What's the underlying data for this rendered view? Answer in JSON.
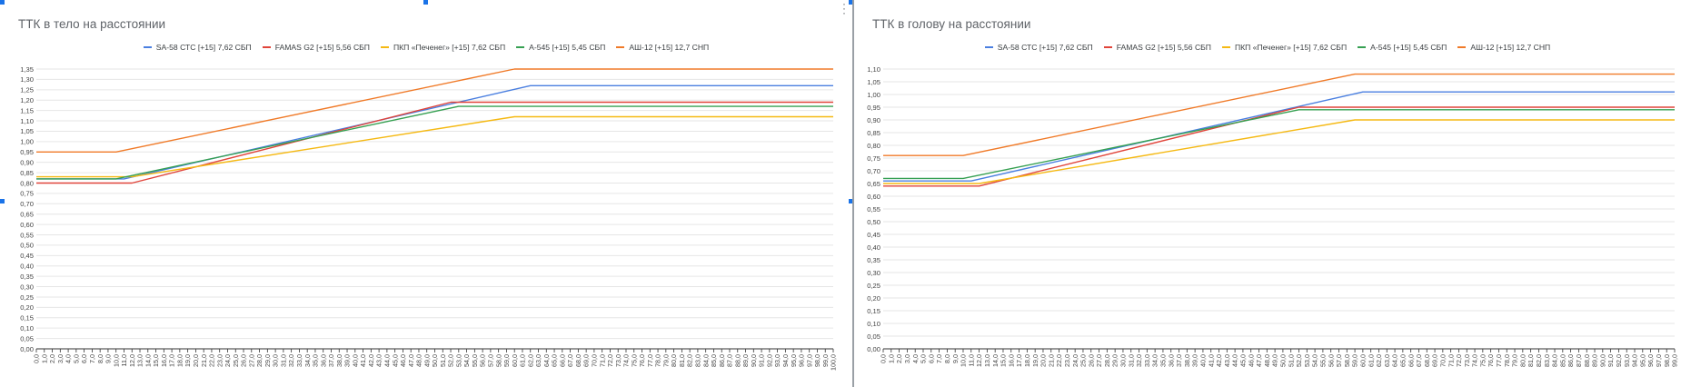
{
  "series_colors": [
    "#4a7fe0",
    "#e0443a",
    "#f5b913",
    "#36a052",
    "#f07a28"
  ],
  "chart_data": [
    {
      "type": "line",
      "title": "ТТК в тело на расстоянии",
      "series_names": [
        "SA-58 СТС [+15] 7,62 СБП",
        "FAMAS G2 [+15] 5,56 СБП",
        "ПКП «Печенег» [+15] 7,62 СБП",
        "A-545 [+15] 5,45 СБП",
        "АШ-12 [+15] 12,7 СНП"
      ],
      "xlim": [
        0,
        100
      ],
      "x_ticks": [
        "0,0",
        "1,0",
        "2,0",
        "3,0",
        "4,0",
        "5,0",
        "6,0",
        "7,0",
        "8,0",
        "9,0",
        "10,0",
        "11,0",
        "12,0",
        "13,0",
        "14,0",
        "15,0",
        "16,0",
        "17,0",
        "18,0",
        "19,0",
        "20,0",
        "21,0",
        "22,0",
        "23,0",
        "24,0",
        "25,0",
        "26,0",
        "27,0",
        "28,0",
        "29,0",
        "30,0",
        "31,0",
        "32,0",
        "33,0",
        "34,0",
        "35,0",
        "36,0",
        "37,0",
        "38,0",
        "39,0",
        "40,0",
        "41,0",
        "42,0",
        "43,0",
        "44,0",
        "45,0",
        "46,0",
        "47,0",
        "48,0",
        "49,0",
        "50,0",
        "51,0",
        "52,0",
        "53,0",
        "54,0",
        "55,0",
        "56,0",
        "57,0",
        "58,0",
        "59,0",
        "60,0",
        "61,0",
        "62,0",
        "63,0",
        "64,0",
        "65,0",
        "66,0",
        "67,0",
        "68,0",
        "69,0",
        "70,0",
        "71,0",
        "72,0",
        "73,0",
        "74,0",
        "75,0",
        "76,0",
        "77,0",
        "78,0",
        "79,0",
        "80,0",
        "81,0",
        "82,0",
        "83,0",
        "84,0",
        "85,0",
        "86,0",
        "87,0",
        "88,0",
        "89,0",
        "90,0",
        "91,0",
        "92,0",
        "93,0",
        "94,0",
        "95,0",
        "96,0",
        "97,0",
        "98,0",
        "99,0",
        "100,0"
      ],
      "ylim": [
        0,
        1.35
      ],
      "y_ticks": [
        "0,00",
        "0,05",
        "0,10",
        "0,15",
        "0,20",
        "0,25",
        "0,30",
        "0,35",
        "0,40",
        "0,45",
        "0,50",
        "0,55",
        "0,60",
        "0,65",
        "0,70",
        "0,75",
        "0,80",
        "0,85",
        "0,90",
        "0,95",
        "1,00",
        "1,05",
        "1,10",
        "1,15",
        "1,20",
        "1,25",
        "1,30",
        "1,35"
      ],
      "series": [
        {
          "name": "SA-58 СТС [+15] 7,62 СБП",
          "points": [
            [
              0,
              0.82
            ],
            [
              11,
              0.82
            ],
            [
              62,
              1.27
            ],
            [
              100,
              1.27
            ]
          ]
        },
        {
          "name": "FAMAS G2 [+15] 5,56 СБП",
          "points": [
            [
              0,
              0.8
            ],
            [
              12,
              0.8
            ],
            [
              52,
              1.19
            ],
            [
              100,
              1.19
            ]
          ]
        },
        {
          "name": "ПКП «Печенег» [+15] 7,62 СБП",
          "points": [
            [
              0,
              0.83
            ],
            [
              12,
              0.83
            ],
            [
              60,
              1.12
            ],
            [
              100,
              1.12
            ]
          ]
        },
        {
          "name": "A-545 [+15] 5,45 СБП",
          "points": [
            [
              0,
              0.82
            ],
            [
              10,
              0.82
            ],
            [
              53,
              1.17
            ],
            [
              100,
              1.17
            ]
          ]
        },
        {
          "name": "АШ-12 [+15] 12,7 СНП",
          "points": [
            [
              0,
              0.95
            ],
            [
              10,
              0.95
            ],
            [
              60,
              1.35
            ],
            [
              100,
              1.35
            ]
          ]
        }
      ]
    },
    {
      "type": "line",
      "title": "ТТК в голову на расстоянии",
      "series_names": [
        "SA-58 СТС [+15] 7,62 СБП",
        "FAMAS G2 [+15] 5,56 СБП",
        "ПКП «Печенег» [+15] 7,62 СБП",
        "A-545 [+15] 5,45 СБП",
        "АШ-12 [+15] 12,7 СНП"
      ],
      "xlim": [
        0,
        99
      ],
      "x_ticks": [
        "0,0",
        "1,0",
        "2,0",
        "3,0",
        "4,0",
        "5,0",
        "6,0",
        "7,0",
        "8,0",
        "9,0",
        "10,0",
        "11,0",
        "12,0",
        "13,0",
        "14,0",
        "15,0",
        "16,0",
        "17,0",
        "18,0",
        "19,0",
        "20,0",
        "21,0",
        "22,0",
        "23,0",
        "24,0",
        "25,0",
        "26,0",
        "27,0",
        "28,0",
        "29,0",
        "30,0",
        "31,0",
        "32,0",
        "33,0",
        "34,0",
        "35,0",
        "36,0",
        "37,0",
        "38,0",
        "39,0",
        "40,0",
        "41,0",
        "42,0",
        "43,0",
        "44,0",
        "45,0",
        "46,0",
        "47,0",
        "48,0",
        "49,0",
        "50,0",
        "51,0",
        "52,0",
        "53,0",
        "54,0",
        "55,0",
        "56,0",
        "57,0",
        "58,0",
        "59,0",
        "60,0",
        "61,0",
        "62,0",
        "63,0",
        "64,0",
        "65,0",
        "66,0",
        "67,0",
        "68,0",
        "69,0",
        "70,0",
        "71,0",
        "72,0",
        "73,0",
        "74,0",
        "75,0",
        "76,0",
        "77,0",
        "78,0",
        "79,0",
        "80,0",
        "81,0",
        "82,0",
        "83,0",
        "84,0",
        "85,0",
        "86,0",
        "87,0",
        "88,0",
        "89,0",
        "90,0",
        "91,0",
        "92,0",
        "93,0",
        "94,0",
        "95,0",
        "96,0",
        "97,0",
        "98,0",
        "99,0"
      ],
      "ylim": [
        0,
        1.1
      ],
      "y_ticks": [
        "0,00",
        "0,05",
        "0,10",
        "0,15",
        "0,20",
        "0,25",
        "0,30",
        "0,35",
        "0,40",
        "0,45",
        "0,50",
        "0,55",
        "0,60",
        "0,65",
        "0,70",
        "0,75",
        "0,80",
        "0,85",
        "0,90",
        "0,95",
        "1,00",
        "1,05",
        "1,10"
      ],
      "series": [
        {
          "name": "SA-58 СТС [+15] 7,62 СБП",
          "points": [
            [
              0,
              0.66
            ],
            [
              11,
              0.66
            ],
            [
              60,
              1.01
            ],
            [
              99,
              1.01
            ]
          ]
        },
        {
          "name": "FAMAS G2 [+15] 5,56 СБП",
          "points": [
            [
              0,
              0.64
            ],
            [
              12,
              0.64
            ],
            [
              52,
              0.95
            ],
            [
              99,
              0.95
            ]
          ]
        },
        {
          "name": "ПКП «Печенег» [+15] 7,62 СБП",
          "points": [
            [
              0,
              0.65
            ],
            [
              12,
              0.65
            ],
            [
              59,
              0.9
            ],
            [
              99,
              0.9
            ]
          ]
        },
        {
          "name": "A-545 [+15] 5,45 СБП",
          "points": [
            [
              0,
              0.67
            ],
            [
              10,
              0.67
            ],
            [
              52,
              0.94
            ],
            [
              99,
              0.94
            ]
          ]
        },
        {
          "name": "АШ-12 [+15] 12,7 СНП",
          "points": [
            [
              0,
              0.76
            ],
            [
              10,
              0.76
            ],
            [
              59,
              1.08
            ],
            [
              99,
              1.08
            ]
          ]
        }
      ]
    }
  ]
}
